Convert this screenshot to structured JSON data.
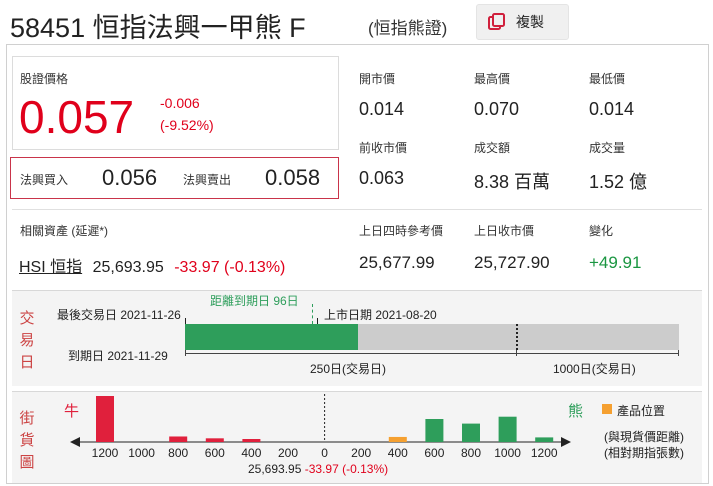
{
  "header": {
    "code": "58451",
    "name": "恒指法興一甲熊 F",
    "subtitle": "(恒指熊證)",
    "copy_label": "複製"
  },
  "quote": {
    "price_label": "股證價格",
    "price": "0.057",
    "change": "-0.006",
    "change_pct": "(-9.52%)",
    "bid_label": "法興買入",
    "bid": "0.056",
    "ask_label": "法興賣出",
    "ask": "0.058"
  },
  "stats": [
    {
      "label": "開市價",
      "value": "0.014"
    },
    {
      "label": "最高價",
      "value": "0.070"
    },
    {
      "label": "最低價",
      "value": "0.014"
    },
    {
      "label": "前收市價",
      "value": "0.063"
    },
    {
      "label": "成交額",
      "value": "8.38 百萬"
    },
    {
      "label": "成交量",
      "value": "1.52 億"
    }
  ],
  "underlying": {
    "label": "相關資產 (延遲*)",
    "name": "HSI 恒指",
    "price": "25,693.95",
    "change": "-33.97 (-0.13%)",
    "ref_label": "上日四時參考價",
    "ref_value": "25,677.99",
    "close_label": "上日收市價",
    "close_value": "25,727.90",
    "diff_label": "變化",
    "diff_value": "+49.91"
  },
  "trading_days": {
    "section_label": [
      "交",
      "易",
      "日"
    ],
    "last_trade": "最後交易日 2021-11-26",
    "days_to_expiry": "距離到期日 96日",
    "listing_date": "上市日期 2021-08-20",
    "expiry": "到期日 2021-11-29",
    "mark_250": "250日(交易日)",
    "mark_1000": "1000日(交易日)",
    "remaining_fraction": 0.35,
    "colors": {
      "remaining": "#2e9e5b",
      "track": "#cccccc"
    }
  },
  "street": {
    "section_label": [
      "街",
      "貨",
      "圖"
    ],
    "bull_label": "牛",
    "bear_label": "熊",
    "legend_label": "產品位置",
    "note1": "(與現貨價距離)",
    "note2": "(相對期指張數)",
    "center_label": "25,693.95",
    "center_change": "-33.97 (-0.13%)",
    "ticks": [
      "1200",
      "1000",
      "800",
      "600",
      "400",
      "200",
      "0",
      "200",
      "400",
      "600",
      "800",
      "1000",
      "1200"
    ],
    "colors": {
      "bull": "#e0203c",
      "bear": "#2e9e5b",
      "product": "#f5a030"
    }
  },
  "chart_data": {
    "type": "bar",
    "title": "",
    "categories": [
      "1200",
      "1000",
      "800",
      "600",
      "400",
      "200",
      "0",
      "200",
      "400",
      "600",
      "800",
      "1000",
      "1200"
    ],
    "series": [
      {
        "name": "牛",
        "values": [
          10,
          0,
          1.2,
          0.8,
          0.6,
          0,
          0,
          0,
          0,
          0,
          0,
          0,
          0
        ]
      },
      {
        "name": "熊",
        "values": [
          0,
          0,
          0,
          0,
          0,
          0,
          0,
          0,
          1.1,
          5,
          4,
          5.5,
          1
        ]
      }
    ],
    "highlight_index": 8,
    "xlabel": "",
    "ylabel": ""
  }
}
